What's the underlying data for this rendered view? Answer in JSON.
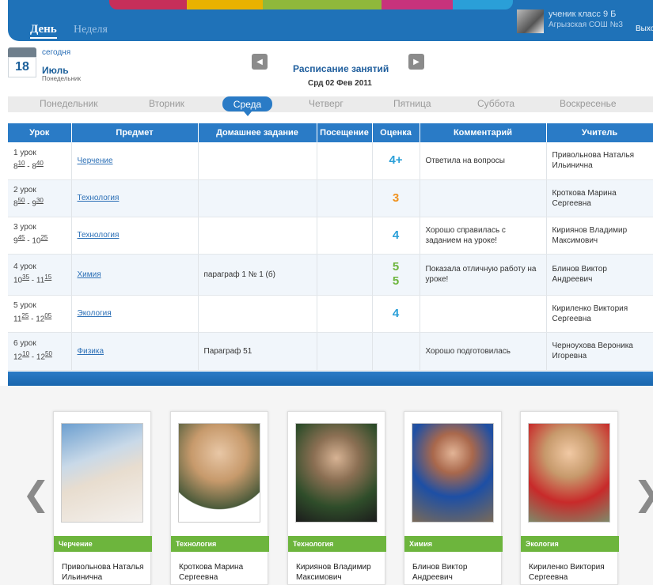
{
  "header": {
    "tab_day": "День",
    "tab_week": "Неделя",
    "user_line1": "ученик класс 9 Б",
    "user_line2": "Агрызская СОШ №3",
    "logout": "Выхо",
    "brand_strip_colors": [
      "#c62f5a",
      "#e9b200",
      "#8fb83b",
      "#c8337c",
      "#2a9fd8"
    ]
  },
  "date": {
    "today_label": "сегодня",
    "day": "18",
    "month": "Июль",
    "weekday": "Понедельник"
  },
  "schedule": {
    "title": "Расписание занятий",
    "date": "Срд 02 Фев 2011",
    "prev_icon": "◀",
    "next_icon": "▶"
  },
  "week_tabs": [
    "Понедельник",
    "Вторник",
    "Среда",
    "Четверг",
    "Пятница",
    "Суббота",
    "Воскресенье"
  ],
  "table": {
    "headers": [
      "Урок",
      "Предмет",
      "Домашнее задание",
      "Посещение",
      "Оценка",
      "Комментарий",
      "Учитель"
    ],
    "rows": [
      {
        "lesson": "1 урок",
        "time_start_h": "8",
        "time_start_m": "10",
        "time_end_h": "8",
        "time_end_m": "40",
        "subject": "Черчение",
        "homework": "",
        "attendance": "",
        "grade": "4+",
        "grade2": "",
        "grade_color": "#2a9fd8",
        "comment": "Ответила на вопросы",
        "teacher": "Привольнова Наталья Ильинична"
      },
      {
        "lesson": "2 урок",
        "time_start_h": "8",
        "time_start_m": "50",
        "time_end_h": "9",
        "time_end_m": "30",
        "subject": "Технология",
        "homework": "",
        "attendance": "",
        "grade": "3",
        "grade2": "",
        "grade_color": "#f0921e",
        "comment": "",
        "teacher": "Кроткова Марина Сергеевна"
      },
      {
        "lesson": "3 урок",
        "time_start_h": "9",
        "time_start_m": "45",
        "time_end_h": "10",
        "time_end_m": "25",
        "subject": "Технология",
        "homework": "",
        "attendance": "",
        "grade": "4",
        "grade2": "",
        "grade_color": "#2a9fd8",
        "comment": "Хорошо справилась с заданием на уроке!",
        "teacher": "Кириянов Владимир Максимович"
      },
      {
        "lesson": "4 урок",
        "time_start_h": "10",
        "time_start_m": "35",
        "time_end_h": "11",
        "time_end_m": "15",
        "subject": "Химия",
        "homework": "параграф 1 № 1 (б)",
        "attendance": "",
        "grade": "5",
        "grade2": "5",
        "grade_color": "#6db53d",
        "comment": "Показала отличную работу на уроке!",
        "teacher": "Блинов Виктор Андреевич"
      },
      {
        "lesson": "5 урок",
        "time_start_h": "11",
        "time_start_m": "25",
        "time_end_h": "12",
        "time_end_m": "05",
        "subject": "Экология",
        "homework": "",
        "attendance": "",
        "grade": "4",
        "grade2": "",
        "grade_color": "#2a9fd8",
        "comment": "",
        "teacher": "Кириленко Виктория Сергеевна"
      },
      {
        "lesson": "6 урок",
        "time_start_h": "12",
        "time_start_m": "10",
        "time_end_h": "12",
        "time_end_m": "50",
        "subject": "Физика",
        "homework": "Параграф 51",
        "attendance": "",
        "grade": "",
        "grade2": "",
        "grade_color": "#2a9fd8",
        "comment": "Хорошо подготовилась",
        "teacher": "Черноухова Вероника Игоревна"
      }
    ]
  },
  "teachers": [
    {
      "subject": "Черчение",
      "name": "Привольнова Наталья Ильинична"
    },
    {
      "subject": "Технология",
      "name": "Кроткова Марина Сергеевна"
    },
    {
      "subject": "Технология",
      "name": "Кириянов Владимир Максимович"
    },
    {
      "subject": "Химия",
      "name": "Блинов Виктор Андреевич"
    },
    {
      "subject": "Экология",
      "name": "Кириленко Виктория Сергеевна"
    }
  ],
  "carousel": {
    "prev_icon": "❮",
    "next_icon": "❯"
  }
}
